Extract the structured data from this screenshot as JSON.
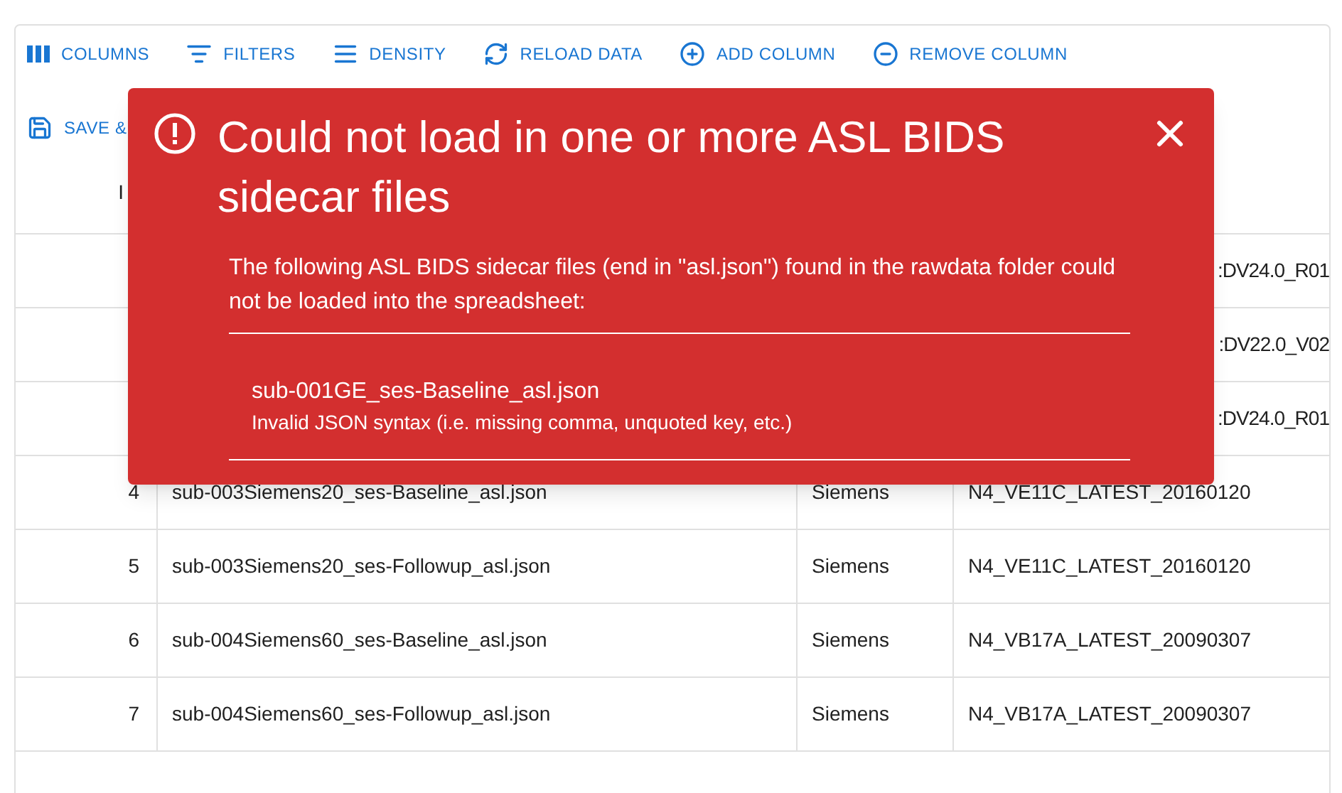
{
  "toolbar": {
    "buttons": [
      {
        "kind": "columns",
        "label": "COLUMNS"
      },
      {
        "kind": "filters",
        "label": "FILTERS"
      },
      {
        "kind": "density",
        "label": "DENSITY"
      },
      {
        "kind": "reload",
        "label": "RELOAD DATA"
      },
      {
        "kind": "add",
        "label": "ADD COLUMN"
      },
      {
        "kind": "remove",
        "label": "REMOVE COLUMN"
      },
      {
        "kind": "save",
        "label": "SAVE &"
      }
    ]
  },
  "table": {
    "header": {
      "column_1": "I"
    },
    "rows": [
      {
        "version": ":DV24.0_R01"
      },
      {
        "version": ":DV22.0_V02"
      },
      {
        "version": ":DV24.0_R01"
      },
      {
        "index": "4",
        "file": "sub-003Siemens20_ses-Baseline_asl.json",
        "vendor": "Siemens",
        "version": "N4_VE11C_LATEST_20160120"
      },
      {
        "index": "5",
        "file": "sub-003Siemens20_ses-Followup_asl.json",
        "vendor": "Siemens",
        "version": "N4_VE11C_LATEST_20160120"
      },
      {
        "index": "6",
        "file": "sub-004Siemens60_ses-Baseline_asl.json",
        "vendor": "Siemens",
        "version": "N4_VB17A_LATEST_20090307"
      },
      {
        "index": "7",
        "file": "sub-004Siemens60_ses-Followup_asl.json",
        "vendor": "Siemens",
        "version": "N4_VB17A_LATEST_20090307"
      }
    ]
  },
  "alert": {
    "title": "Could not load in one or more ASL BIDS sidecar files",
    "message": "The following ASL BIDS sidecar files (end in \"asl.json\") found in the rawdata folder could not be loaded into the spreadsheet:",
    "errors": [
      {
        "file": "sub-001GE_ses-Baseline_asl.json",
        "reason": "Invalid JSON syntax (i.e. missing comma, unquoted key, etc.)"
      }
    ]
  }
}
